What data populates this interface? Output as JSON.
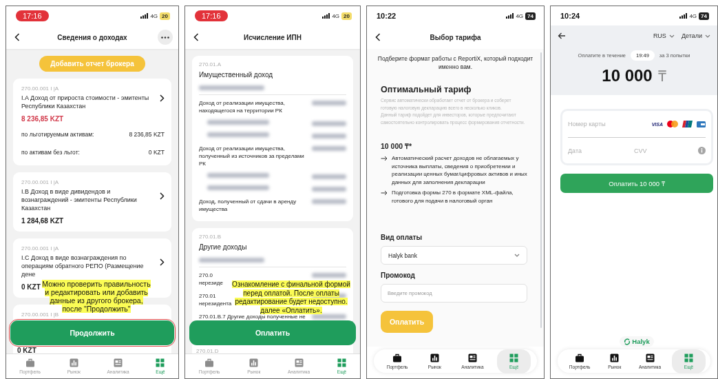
{
  "screens": [
    {
      "kind": "income",
      "status": {
        "time": "17:16",
        "recording": true,
        "network": "4G",
        "battery": "20",
        "low_power": true
      },
      "header": {
        "title": "Сведения о доходах",
        "more_button": true
      },
      "add_button": "Добавить отчет брокера",
      "cards": [
        {
          "code": "270.00.001 I |A",
          "title": "I.A Доход от прироста стоимости - эмитенты Республики Казахстан",
          "amount": "8 236,85 KZT",
          "accent": true,
          "rows": [
            {
              "label": "по льготируемым активам:",
              "value": "8 236,85 KZT"
            },
            {
              "label": "по активам без льгот:",
              "value": "0 KZT"
            }
          ]
        },
        {
          "code": "270.00.001 I |A",
          "title": "I.B Доход в виде дивидендов и вознаграждений - эмитенты Республики Казахстан",
          "amount": "1 284,68 KZT",
          "accent": false
        },
        {
          "code": "270.00.001 I |A",
          "title": "I.C Доход в виде вознаграждения по операциям обратного РЕПО (Размещение дене",
          "amount": "0 KZT",
          "accent": false
        },
        {
          "code": "270.00.001 I |B"
        }
      ],
      "primary_button": {
        "label": "Продолжить",
        "highlighted": true
      },
      "below_button": "0 KZT",
      "note": "Можно проверить правильность и редактировать или добавить данные из другого брокера, после  \"Продолжить\"",
      "nav": {
        "items": [
          {
            "label": "Портфель",
            "selected": false
          },
          {
            "label": "Рынок",
            "selected": false
          },
          {
            "label": "Аналитика",
            "selected": false
          },
          {
            "label": "Ещё",
            "selected": true
          }
        ]
      }
    },
    {
      "kind": "tax",
      "status": {
        "time": "17:16",
        "recording": true,
        "network": "4G",
        "battery": "20",
        "low_power": true
      },
      "header": {
        "title": "Исчисление ИПН"
      },
      "sections": [
        {
          "code": "270.01.A",
          "title": "Имущественный доход",
          "rows": [
            {
              "kind": "text",
              "lines": [
                "Доход от реализации имущества,",
                "находящегося на территории РК"
              ]
            },
            {
              "kind": "hidden"
            },
            {
              "kind": "hidden"
            },
            {
              "kind": "text",
              "lines": [
                "Доход от реализации имущества,",
                "полученный из источников за пределами",
                "РК"
              ]
            },
            {
              "kind": "hidden"
            },
            {
              "kind": "hidden"
            },
            {
              "kind": "text",
              "lines": [
                "Доход, полученный от сдачи в аренду",
                "имущества"
              ]
            }
          ]
        },
        {
          "code": "270.01.B",
          "title": "Другие доходы",
          "rows": [
            {
              "kind": "text",
              "lines": [
                "270.0",
                "нерезиде"
              ]
            },
            {
              "kind": "text",
              "lines": [
                "270.01",
                "нерезидента"
              ]
            },
            {
              "kind": "text",
              "lines": [
                "270.01.B.7 Другие доходы полученные не"
              ]
            }
          ]
        }
      ],
      "primary_button": {
        "label": "Оплатить",
        "highlighted": false
      },
      "below_button": "270.01.D",
      "note": "Ознакомление с финальной формой перед оплатой. После оплаты редактирование будет недоступно. далее «Оплатить».",
      "nav": {
        "items": [
          {
            "label": "Портфель",
            "selected": false
          },
          {
            "label": "Рынок",
            "selected": false
          },
          {
            "label": "Аналитика",
            "selected": false
          },
          {
            "label": "Ещё",
            "selected": true
          }
        ]
      }
    },
    {
      "kind": "tariff",
      "status": {
        "time": "10:22",
        "recording": false,
        "network": "4G",
        "battery": "74",
        "low_power": false
      },
      "header": {
        "title": "Выбор тарифа"
      },
      "intro": "Подберите формат работы с ReportiX, который подходит именно вам.",
      "plan": {
        "title": "Оптимальный тариф",
        "description": [
          "Сервис автоматически обработает отчет от брокера и соберет готовую налоговую декларацию всего в несколько кликов.",
          "Данный тариф подойдет для инвесторов, которые предпочитают самостоятельно контролировать процесс формирования отчетности."
        ],
        "price": "10 000 ₸*",
        "features": [
          "Автоматический расчет доходов не облагаемых у источника выплаты, сведения о приобретении и реализации ценных бумаг/цифровых активов и иных данных для заполнения декларации",
          "Подготовка формы 270 в формате XML-файла, готового для подачи в налоговый орган"
        ]
      },
      "payment": {
        "label": "Вид оплаты",
        "value": "Halyk bank"
      },
      "promo": {
        "label": "Промокод",
        "placeholder": "Введите промокод"
      },
      "primary_button": {
        "label": "Оплатить",
        "highlighted": false
      },
      "nav": {
        "items": [
          {
            "label": "Портфель",
            "selected": false
          },
          {
            "label": "Рынок",
            "selected": false
          },
          {
            "label": "Аналитика",
            "selected": false
          },
          {
            "label": "Ещё",
            "selected": true
          }
        ]
      }
    },
    {
      "kind": "payment",
      "status": {
        "time": "10:24",
        "recording": false,
        "network": "4G",
        "battery": "74",
        "low_power": false
      },
      "language": "RUS",
      "details": "Детали",
      "timer": {
        "label": "Оплатите в течение",
        "value": "19:49",
        "attempts": "за 3 попытки"
      },
      "amount": "10 000",
      "currency": "₸",
      "card_form": {
        "number_placeholder": "Номер карты",
        "brand": "VISA",
        "date_placeholder": "Дата",
        "cvv_placeholder": "CVV"
      },
      "primary_button": {
        "label": "Оплатить 10 000 ₸",
        "highlighted": false
      },
      "logo": "Halyk",
      "nav": {
        "items": [
          {
            "label": "Портфель",
            "selected": false
          },
          {
            "label": "Рынок",
            "selected": false
          },
          {
            "label": "Аналитика",
            "selected": false
          },
          {
            "label": "Ещё",
            "selected": true
          }
        ]
      }
    }
  ]
}
